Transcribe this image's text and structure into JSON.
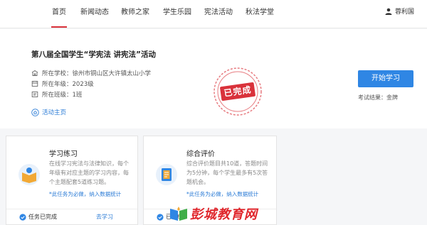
{
  "nav": {
    "items": [
      "首页",
      "新闻动态",
      "教师之家",
      "学生乐园",
      "宪法活动",
      "秋法学堂"
    ],
    "user_name": "蓉利国"
  },
  "hero": {
    "title": "第八届全国学生“学宪法 讲宪法”活动",
    "school": "所在学校：徐州市铜山区大许镇太山小学",
    "grade": "所在年级：2023级",
    "class": "所在班级：1班",
    "activity_link": "活动主页",
    "stamp": "已完成",
    "start_button": "开始学习",
    "result": "考试结果：金牌"
  },
  "cards": [
    {
      "title": "学习练习",
      "desc": "在线学习宪法与法律知识，每个年级有对应主题的学习内容，每个主题配套5道练习题。",
      "note": "*此任务为必做，纳入数据统计",
      "status": "任务已完成",
      "link": "去学习"
    },
    {
      "title": "综合评价",
      "desc": "综合评价题目共10道，答题时间为5分钟，每个学生最多有5次答题机会。",
      "note": "*此任务为必做，纳入数据统计",
      "status": "已完成",
      "link": ""
    }
  ],
  "watermark": "彭城教育网",
  "colors": {
    "brand_red": "#d9323b",
    "accent_blue": "#2f86e4"
  }
}
